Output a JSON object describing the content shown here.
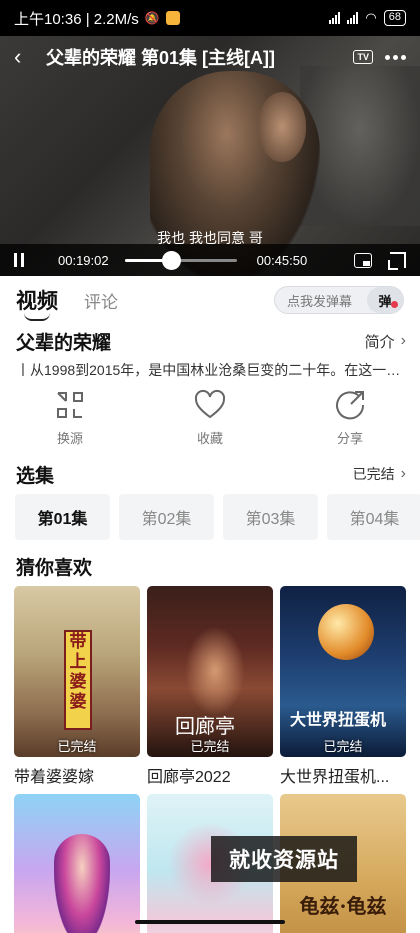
{
  "status_bar": {
    "text": "上午10:36 | 2.2M/s",
    "network": "4G",
    "battery": "68"
  },
  "player": {
    "title": "父辈的荣耀 第01集 [主线[A]]",
    "tv_label": "TV",
    "subtitle": "我也  我也同意  哥",
    "current_time": "00:19:02",
    "total_time": "00:45:50",
    "progress_fraction": 0.415
  },
  "tabs": {
    "video": "视频",
    "comment": "评论",
    "danmu_placeholder": "点我发弹幕",
    "danmu_button": "弹"
  },
  "show": {
    "title": "父辈的荣耀",
    "intro_link": "简介",
    "synopsis": "丨从1998到2015年，是中国林业沧桑巨变的二十年。在这一阶..."
  },
  "actions": [
    {
      "label": "换源",
      "icon": "switch-source-icon"
    },
    {
      "label": "收藏",
      "icon": "heart-icon"
    },
    {
      "label": "分享",
      "icon": "share-icon"
    }
  ],
  "episodes": {
    "title": "选集",
    "status": "已完结",
    "items": [
      "第01集",
      "第02集",
      "第03集",
      "第04集"
    ]
  },
  "recommend": {
    "title": "猜你喜欢",
    "items": [
      {
        "name": "带着婆婆嫁",
        "status": "已完结",
        "poster_text": "带上婆婆"
      },
      {
        "name": "回廊亭2022",
        "status": "已完结",
        "poster_text": "回廊亭"
      },
      {
        "name": "大世界扭蛋机...",
        "status": "已完结",
        "poster_text": "大世界扭蛋机"
      },
      {
        "name": "",
        "status": "",
        "poster_text": ""
      },
      {
        "name": "",
        "status": "",
        "poster_text": ""
      },
      {
        "name": "",
        "status": "",
        "poster_text": "龟兹·龟兹"
      }
    ]
  },
  "watermark": "就收资源站"
}
